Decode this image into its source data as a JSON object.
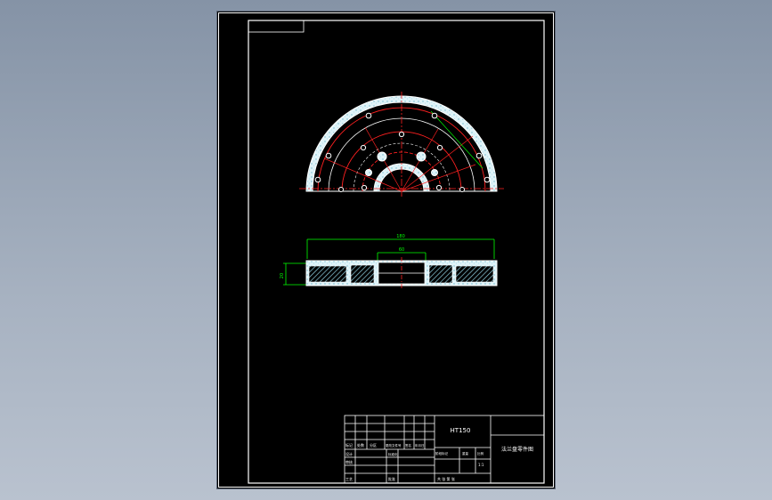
{
  "drawing": {
    "colors": {
      "background": "#000000",
      "frame": "#ffffff",
      "centerline": "#ff2020",
      "dimension": "#00ff00",
      "hatch": "#9fd8e8"
    },
    "section_view": {
      "dim_overall": "180",
      "dim_inner": "60",
      "dim_height": "20"
    },
    "title_block": {
      "material": "HT150",
      "part_name": "法兰盘零件图",
      "labels": {
        "mark": "标记",
        "count": "处数",
        "zone": "分区",
        "change_doc": "更改文件号",
        "signature": "签名",
        "date": "年月日",
        "design": "设计",
        "standardize": "标准化",
        "stage_mark": "阶段标记",
        "weight": "重量",
        "scale": "比例",
        "review": "审核",
        "process": "工艺",
        "approve": "批准",
        "sheets": "共 张 第 张"
      },
      "scale_value": "1:1"
    }
  }
}
